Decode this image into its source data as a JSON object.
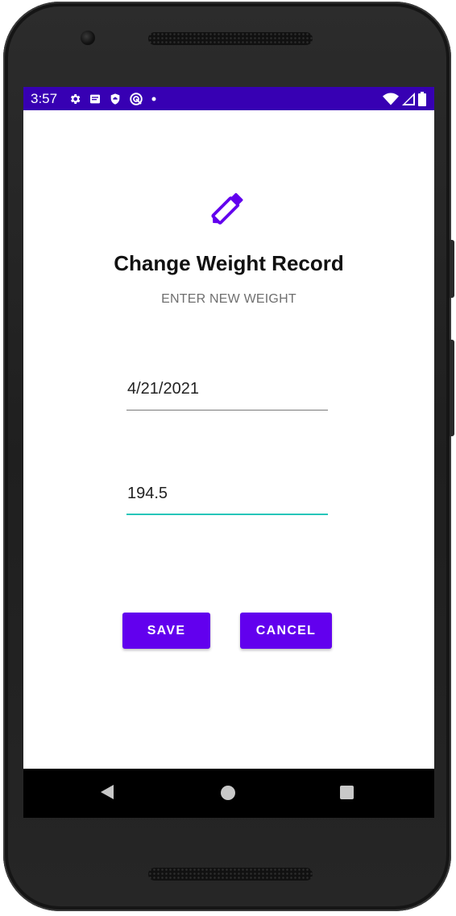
{
  "status_bar": {
    "time": "3:57",
    "color": "#3700b3",
    "left_icons": [
      "settings-icon",
      "notification-icon",
      "shield-icon",
      "sync-icon",
      "dot-icon"
    ],
    "right_icons": [
      "wifi-icon",
      "signal-icon",
      "battery-icon"
    ]
  },
  "header": {
    "icon": "edit-pencil-icon",
    "title": "Change Weight Record",
    "subtitle": "ENTER NEW WEIGHT"
  },
  "form": {
    "date_value": "4/21/2021",
    "weight_value": "194.5",
    "focused_field": "weight",
    "focus_color": "#26c6b9"
  },
  "actions": {
    "save_label": "SAVE",
    "cancel_label": "CANCEL",
    "button_color": "#6200ee"
  },
  "nav_bar": {
    "buttons": [
      "back-icon",
      "home-icon",
      "recents-icon"
    ]
  }
}
